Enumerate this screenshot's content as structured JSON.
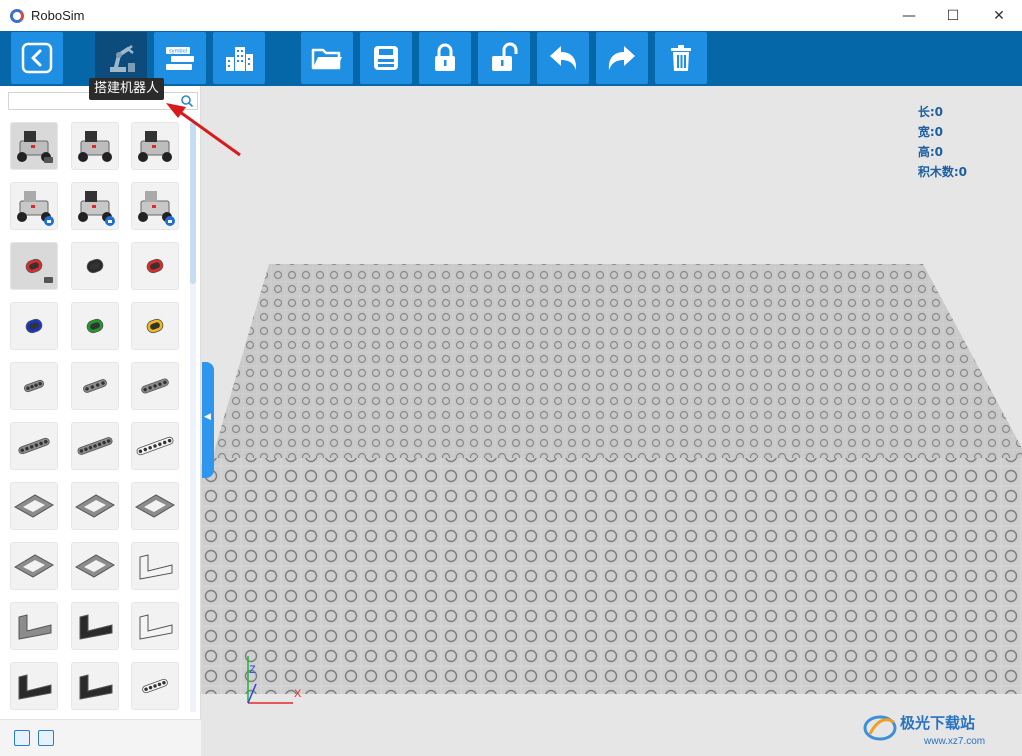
{
  "window": {
    "title": "RoboSim",
    "controls": {
      "minimize": "—",
      "maximize": "☐",
      "close": "✕"
    }
  },
  "toolbar": {
    "buttons": [
      {
        "name": "back",
        "icon": "back-arrow-icon"
      },
      {
        "name": "build-robot",
        "icon": "robot-arm-icon",
        "active": true
      },
      {
        "name": "program",
        "icon": "code-blocks-icon"
      },
      {
        "name": "scene",
        "icon": "buildings-icon"
      },
      {
        "name": "open",
        "icon": "folder-icon"
      },
      {
        "name": "save",
        "icon": "save-icon"
      },
      {
        "name": "lock",
        "icon": "lock-icon"
      },
      {
        "name": "unlock",
        "icon": "unlock-icon"
      },
      {
        "name": "undo",
        "icon": "undo-icon"
      },
      {
        "name": "redo",
        "icon": "redo-icon"
      },
      {
        "name": "delete",
        "icon": "trash-icon"
      }
    ],
    "tooltip": "搭建机器人",
    "program_icon_caption": "symbol"
  },
  "sidebar": {
    "search": {
      "value": "",
      "placeholder": ""
    },
    "parts_rows": [
      [
        "robot-base-black",
        "robot-base-black-2",
        "robot-base-black-3"
      ],
      [
        "robot-gray-locked",
        "robot-mixed-locked",
        "robot-gray-locked-2"
      ],
      [
        "beam-red-3",
        "beam-black-3",
        "beam-red-3b"
      ],
      [
        "beam-blue-3",
        "beam-green-3",
        "beam-yellow-3"
      ],
      [
        "beam-gray-5",
        "beam-gray-7",
        "beam-gray-9"
      ],
      [
        "beam-gray-11",
        "beam-gray-13",
        "beam-white-15"
      ],
      [
        "frame-gray-5x7",
        "frame-gray-h",
        "plate-gray-5x5"
      ],
      [
        "plate-gray-thin",
        "plate-gray-wide",
        "beam-white-angled"
      ],
      [
        "beam-gray-L",
        "beam-black-L",
        "beam-white-double-L"
      ],
      [
        "beam-black-L-short",
        "beam-black-T",
        "beam-white-short"
      ]
    ]
  },
  "viewport": {
    "stats": {
      "length": "长:0",
      "width": "宽:0",
      "height": "高:0",
      "brick_count": "积木数:0"
    },
    "axes": {
      "x": "X",
      "z": "Z"
    },
    "colors": {
      "accent": "#0566a8",
      "button": "#1f8fe3",
      "stats_text": "#1d5fa0"
    }
  },
  "watermark": {
    "brand": "极光下载站",
    "url": "www.xz7.com"
  }
}
